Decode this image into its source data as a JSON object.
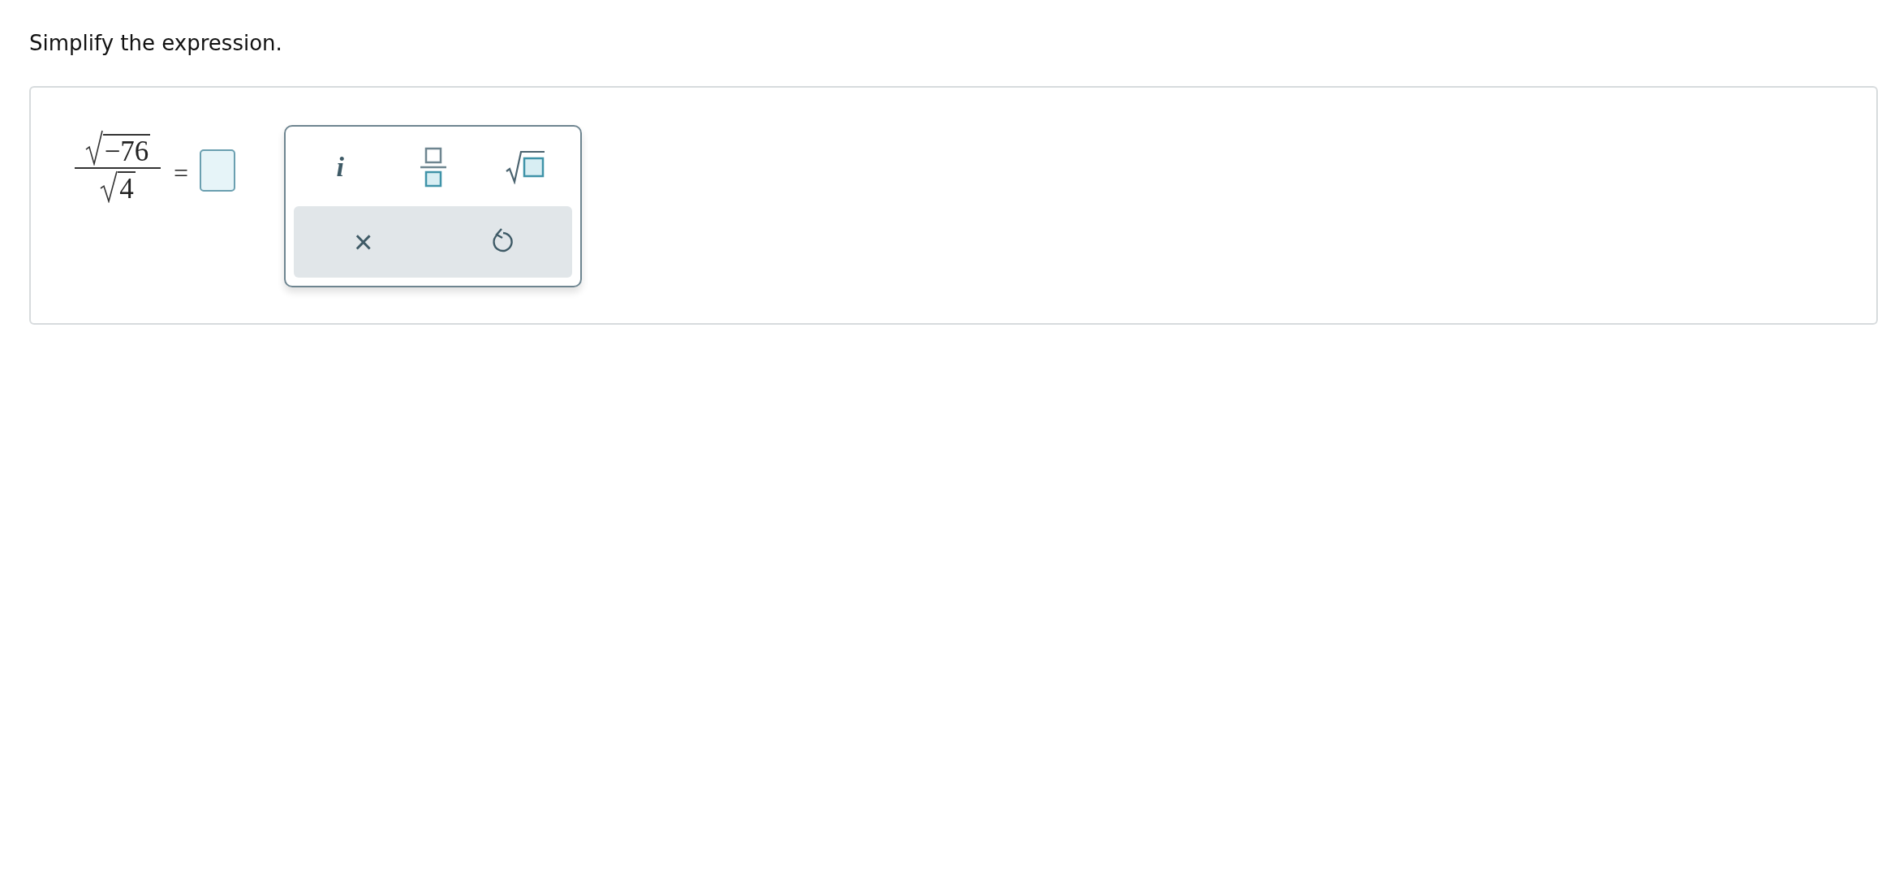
{
  "prompt": "Simplify the expression.",
  "expression": {
    "numerator": "−76",
    "denominator": "4",
    "operator": "="
  },
  "palette": {
    "keys": [
      {
        "kind": "text",
        "label": "i"
      },
      {
        "kind": "fraction"
      },
      {
        "kind": "sqrt"
      }
    ],
    "actions": [
      {
        "kind": "text",
        "label": "×"
      },
      {
        "kind": "undo"
      }
    ]
  }
}
